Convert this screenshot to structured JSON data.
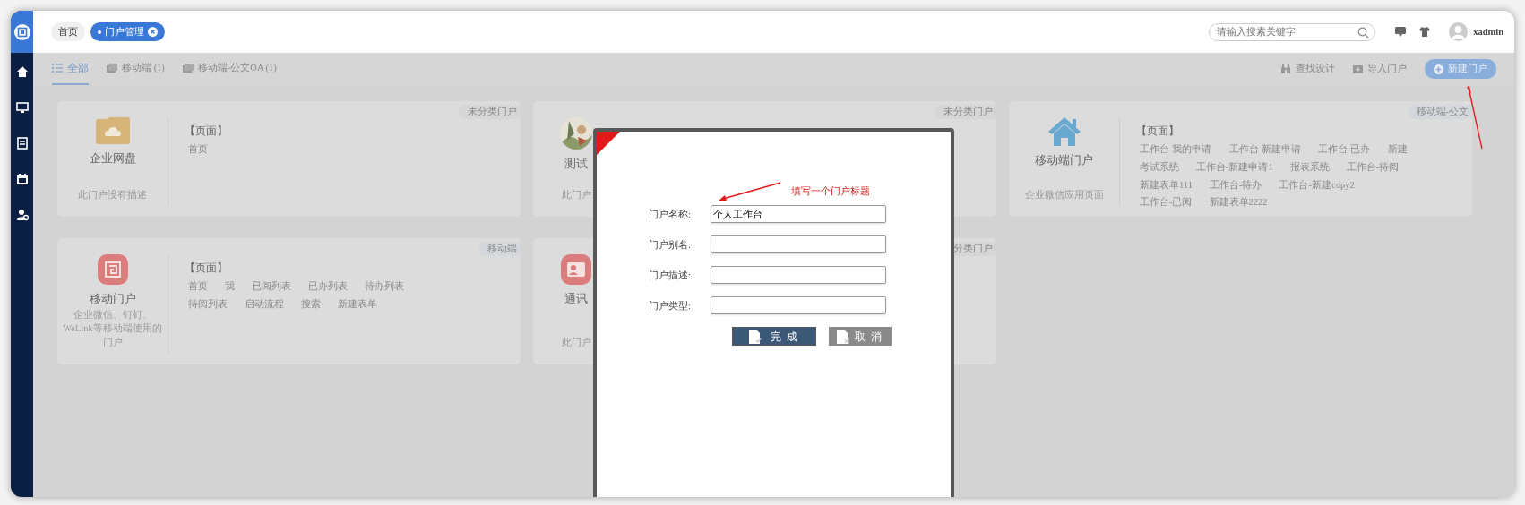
{
  "tags": [
    {
      "label": "首页",
      "selected": false,
      "closable": false
    },
    {
      "label": "门户管理",
      "selected": true,
      "closable": true
    }
  ],
  "search": {
    "placeholder": "请输入搜索关键字"
  },
  "user": {
    "name": "xadmin"
  },
  "tabs": [
    {
      "label": "全部",
      "selected": true
    },
    {
      "label": "移动端 (1)",
      "selected": false
    },
    {
      "label": "移动端-公文OA (1)",
      "selected": false
    }
  ],
  "actions": [
    {
      "label": "查找设计",
      "kind": "link"
    },
    {
      "label": "导入门户",
      "kind": "link"
    },
    {
      "label": "新建门户",
      "kind": "primary"
    }
  ],
  "portals": [
    {
      "name": "企业网盘",
      "description": "此门户没有描述",
      "category": "未分类门户",
      "kind": "plain",
      "section": "【页面】",
      "pages": [
        "首页"
      ]
    },
    {
      "name": "测试",
      "description": "此门户",
      "category": "未分类门户",
      "kind": "plain"
    },
    {
      "name": "移动端门户",
      "description": "企业微信应用页面",
      "category": "移动端-公文",
      "kind": "mobile",
      "section": "【页面】",
      "pages": [
        "工作台-我的申请",
        "工作台-新建申请",
        "工作台-已办",
        "新建",
        "考试系统",
        "工作台-新建申请1",
        "报表系统",
        "工作台-待阅",
        "新建表单111",
        "工作台-待办",
        "工作台-新建copy2",
        "工作台-已阅",
        "新建表单2222"
      ]
    },
    {
      "name": "移动门户",
      "description": "企业微信、钉钉、WeLink等移动端使用的门户",
      "category": "移动端",
      "kind": "mobile",
      "section": "【页面】",
      "pages": [
        "首页",
        "我",
        "已阅列表",
        "已办列表",
        "待办列表",
        "待阅列表",
        "启动流程",
        "搜索",
        "新建表单"
      ]
    },
    {
      "name": "通讯",
      "description": "此门户",
      "category": "分类门户",
      "kind": "plain"
    }
  ],
  "dialog": {
    "annotation": "填写一个门户标题",
    "fields": [
      {
        "label": "门户名称:",
        "value": "个人工作台"
      },
      {
        "label": "门户别名:"
      },
      {
        "label": "门户描述:"
      },
      {
        "label": "门户类型:"
      }
    ],
    "buttons": [
      {
        "label": "完成",
        "kind": "primary"
      },
      {
        "label": "取消",
        "kind": "secondary"
      }
    ]
  }
}
